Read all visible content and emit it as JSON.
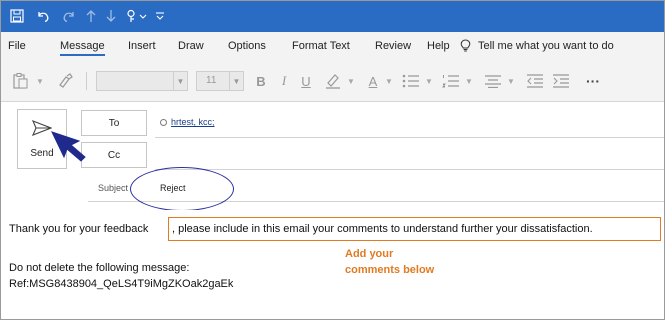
{
  "menu": {
    "tabs": [
      "File",
      "Message",
      "Insert",
      "Draw",
      "Options",
      "Format Text",
      "Review",
      "Help"
    ],
    "active_tab": "Message",
    "tell_me": "Tell me what you want to do"
  },
  "ribbon": {
    "font_size": "11",
    "bold": "B",
    "italic": "I",
    "underline": "U",
    "font_color": "A",
    "more": "···"
  },
  "compose": {
    "send_label": "Send",
    "to_label": "To",
    "cc_label": "Cc",
    "subject_label": "Subject",
    "recipient": "hrtest, kcc;",
    "subject_value": "Reject"
  },
  "body": {
    "line1_start": "Thank you for your feedback",
    "line1_highlight": ", please include in this email your comments to understand further your dissatisfaction.",
    "annotation_line1": "Add your",
    "annotation_line2": "comments below",
    "line2": "Do not delete the following message:",
    "line3": "Ref:MSG8438904_QeLS4T9iMgZKOak2gaEk"
  },
  "colors": {
    "titlebar": "#2a6bc4",
    "highlight": "#e07b22",
    "ellipse": "#2b2f9e"
  }
}
